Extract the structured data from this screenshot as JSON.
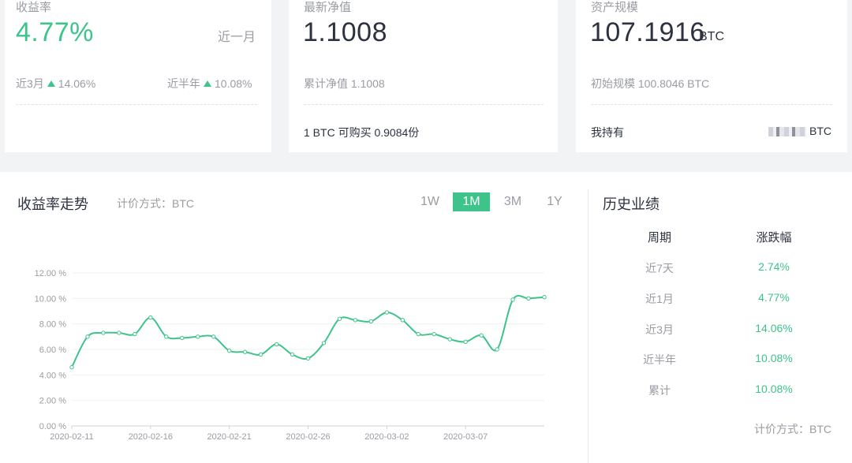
{
  "cards": {
    "yield": {
      "label": "收益率",
      "value": "4.77%",
      "period": "近一月",
      "q3_label": "近3月",
      "q3_value": "14.06%",
      "half_label": "近半年",
      "half_value": "10.08%"
    },
    "nav": {
      "label": "最新净值",
      "value": "1.1008",
      "cumulative": "累计净值 1.1008",
      "buy_text": "1 BTC  可购买  0.9084份"
    },
    "assets": {
      "label": "资产规模",
      "value": "107.1916",
      "unit": "BTC",
      "initial": "初始规模 100.8046 BTC",
      "holding_label": "我持有",
      "holding_unit": "BTC"
    }
  },
  "chart_panel": {
    "title": "收益率走势",
    "pricing": "计价方式：BTC",
    "tabs": [
      "1W",
      "1M",
      "3M",
      "1Y"
    ],
    "active_tab": "1M"
  },
  "history": {
    "title": "历史业绩",
    "col_period": "周期",
    "col_change": "涨跌幅",
    "rows": [
      {
        "period": "近7天",
        "value": "2.74%"
      },
      {
        "period": "近1月",
        "value": "4.77%"
      },
      {
        "period": "近3月",
        "value": "14.06%"
      },
      {
        "period": "近半年",
        "value": "10.08%"
      },
      {
        "period": "累计",
        "value": "10.08%"
      }
    ],
    "footer": "计价方式：BTC"
  },
  "colors": {
    "accent": "#3ec48b",
    "text_dark": "#2c3240",
    "text_muted": "#9a9ca3"
  },
  "chart_data": {
    "type": "line",
    "xlabel": "",
    "ylabel": "",
    "ylim": [
      0,
      12
    ],
    "yticks": [
      "0.00 %",
      "2.00 %",
      "4.00 %",
      "6.00 %",
      "8.00 %",
      "10.00 %",
      "12.00 %"
    ],
    "xticks": [
      "2020-02-11",
      "2020-02-16",
      "2020-02-21",
      "2020-02-26",
      "2020-03-02",
      "2020-03-07"
    ],
    "grid": true,
    "series": [
      {
        "values": [
          4.6,
          7.0,
          7.3,
          7.3,
          7.2,
          8.5,
          7.0,
          6.9,
          7.0,
          7.0,
          5.9,
          5.8,
          5.6,
          6.4,
          5.6,
          5.3,
          6.5,
          8.4,
          8.3,
          8.2,
          8.9,
          8.3,
          7.2,
          7.2,
          6.8,
          6.6,
          7.1,
          6.0,
          9.9,
          10.0,
          10.1
        ]
      }
    ]
  }
}
